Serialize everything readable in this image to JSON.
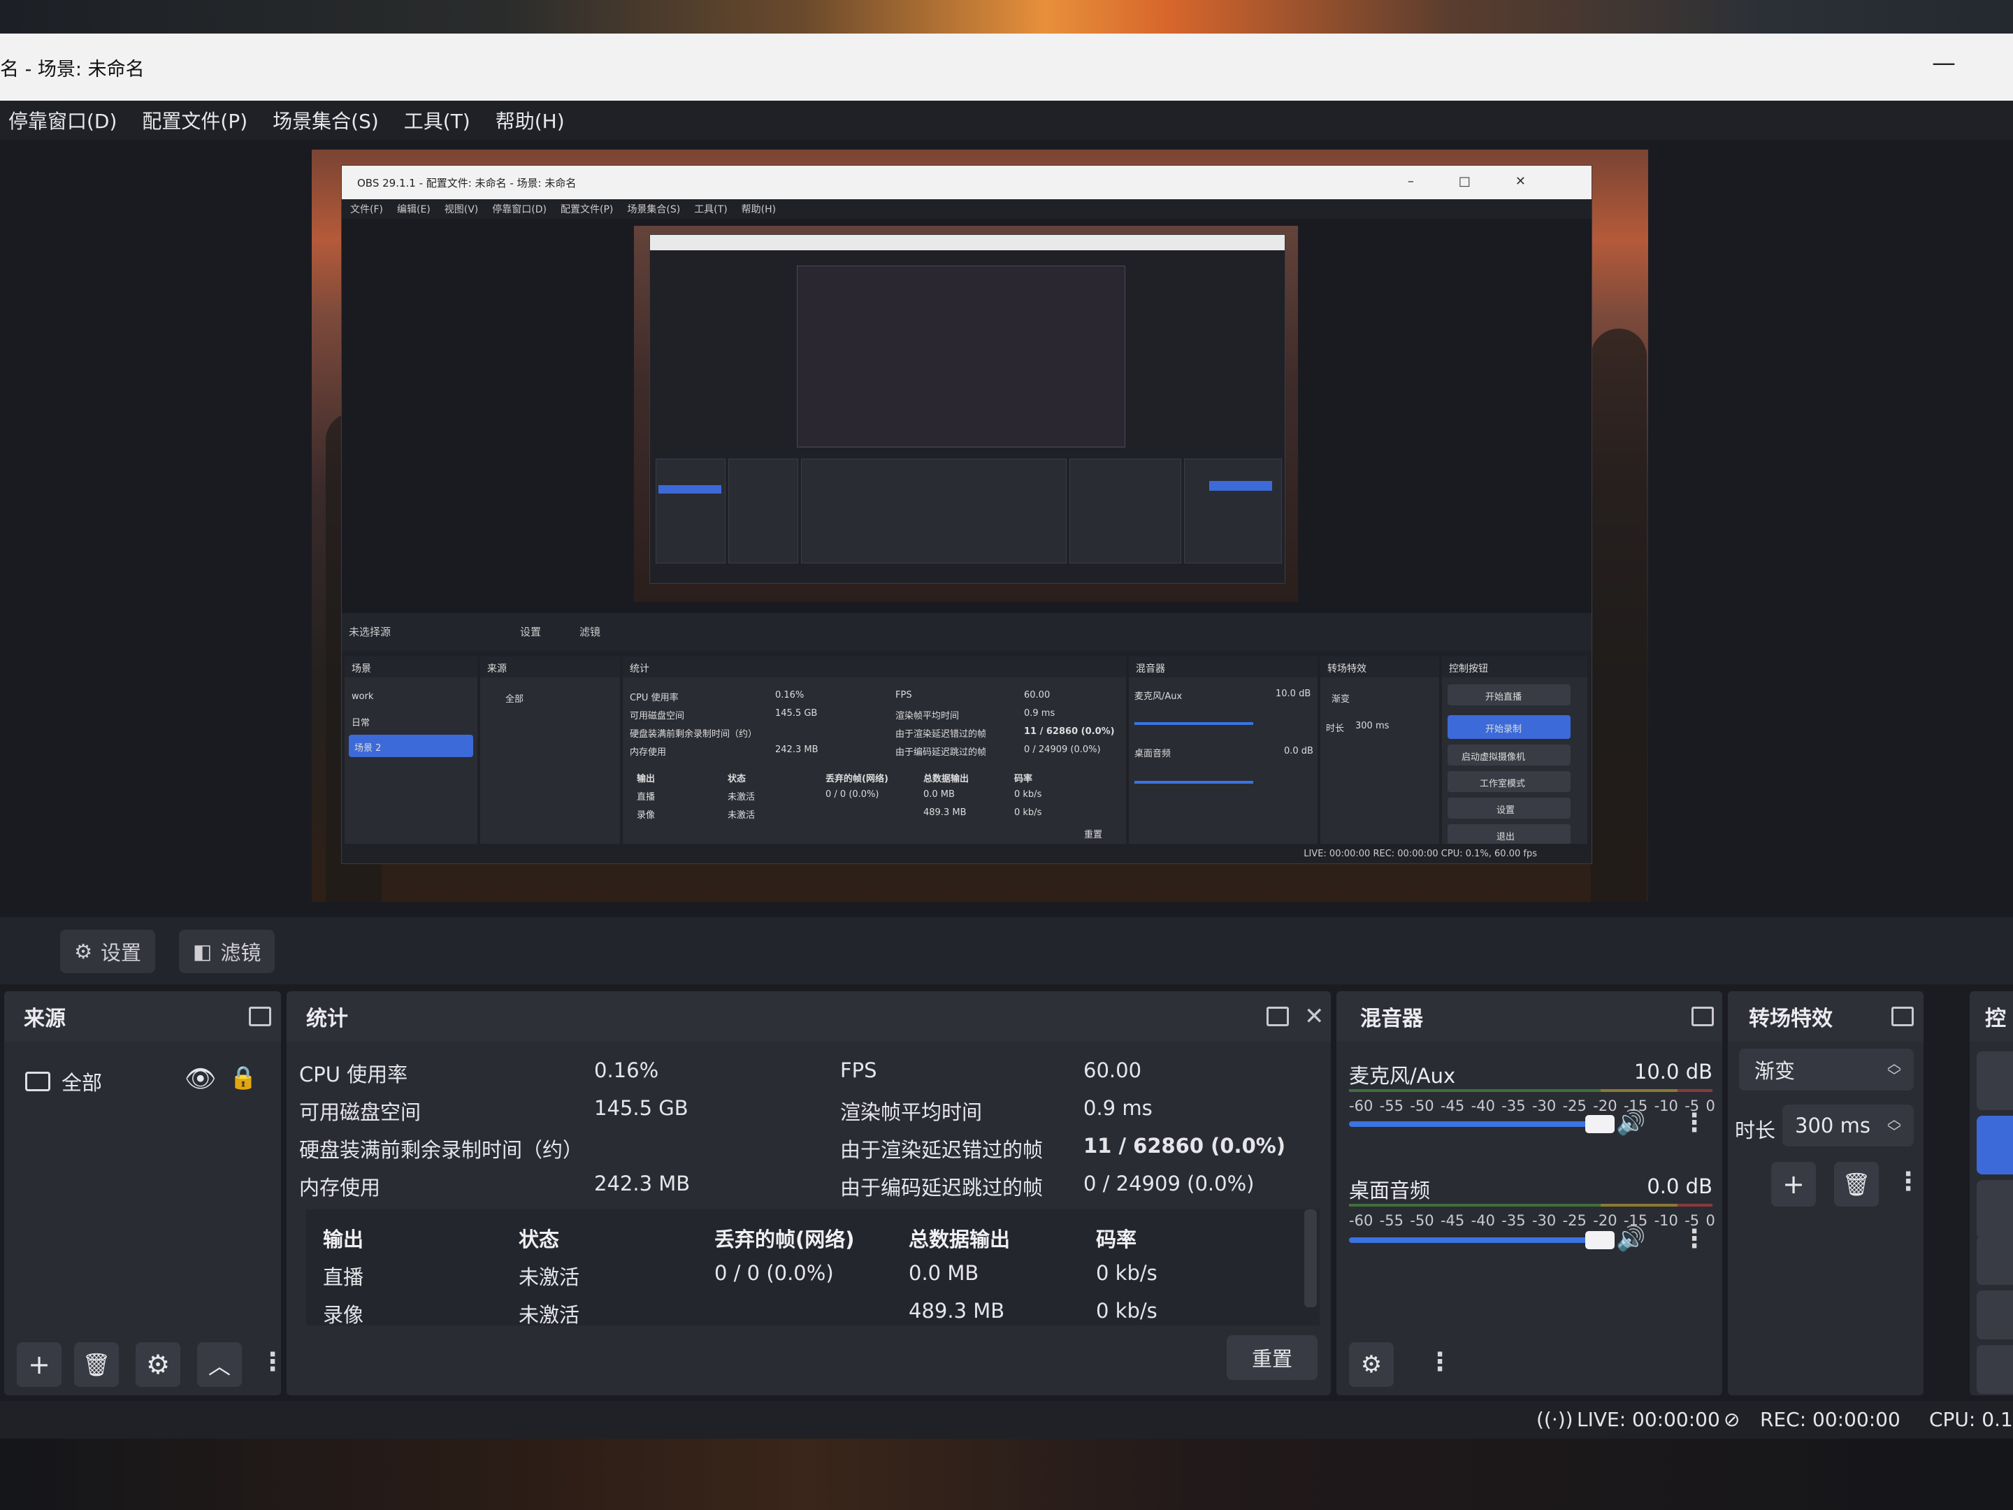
{
  "window": {
    "title": "名 - 场景: 未命名"
  },
  "menu": [
    "停靠窗口(D)",
    "配置文件(P)",
    "场景集合(S)",
    "工具(T)",
    "帮助(H)"
  ],
  "scene_toolbar": {
    "settings": "设置",
    "filters": "滤镜"
  },
  "sources": {
    "title": "来源",
    "items": [
      {
        "name": "全部",
        "visible": true,
        "locked": true
      }
    ]
  },
  "stats": {
    "title": "统计",
    "left": [
      {
        "label": "CPU 使用率",
        "value": "0.16%"
      },
      {
        "label": "可用磁盘空间",
        "value": "145.5 GB"
      },
      {
        "label": "硬盘装满前剩余录制时间（约）",
        "value": ""
      },
      {
        "label": "内存使用",
        "value": "242.3 MB"
      }
    ],
    "right": [
      {
        "label": "FPS",
        "value": "60.00"
      },
      {
        "label": "渲染帧平均时间",
        "value": "0.9 ms"
      },
      {
        "label": "由于渲染延迟错过的帧",
        "value": "11 / 62860 (0.0%)"
      },
      {
        "label": "由于编码延迟跳过的帧",
        "value": "0 / 24909 (0.0%)"
      }
    ],
    "output_table": {
      "headers": [
        "输出",
        "状态",
        "丢弃的帧(网络)",
        "总数据输出",
        "码率"
      ],
      "rows": [
        [
          "直播",
          "未激活",
          "0 / 0 (0.0%)",
          "0.0 MB",
          "0 kb/s"
        ],
        [
          "录像",
          "未激活",
          "",
          "489.3 MB",
          "0 kb/s"
        ]
      ]
    },
    "reset": "重置"
  },
  "mixer": {
    "title": "混音器",
    "scale": [
      "-60",
      "-55",
      "-50",
      "-45",
      "-40",
      "-35",
      "-30",
      "-25",
      "-20",
      "-15",
      "-10",
      "-5",
      "0"
    ],
    "channels": [
      {
        "name": "麦克风/Aux",
        "db": "10.0 dB",
        "volume": 0.92
      },
      {
        "name": "桌面音频",
        "db": "0.0 dB",
        "volume": 0.92
      }
    ]
  },
  "transitions": {
    "title": "转场特效",
    "selected": "渐变",
    "duration_label": "时长",
    "duration": "300 ms"
  },
  "controls": {
    "title": "控"
  },
  "status": {
    "live": "LIVE: 00:00:00",
    "rec": "REC: 00:00:00",
    "cpu": "CPU: 0.1"
  },
  "nested_preview": {
    "title": "OBS 29.1.1 - 配置文件: 未命名 - 场景: 未命名",
    "menu": [
      "文件(F)",
      "编辑(E)",
      "视图(V)",
      "停靠窗口(D)",
      "配置文件(P)",
      "场景集合(S)",
      "工具(T)",
      "帮助(H)"
    ],
    "toolbar_label": "未选择源",
    "toolbar_settings": "设置",
    "toolbar_filters": "滤镜",
    "dock_titles": [
      "场景",
      "来源",
      "统计",
      "混音器",
      "转场特效",
      "控制按钮"
    ],
    "scenes": [
      "work",
      "日常",
      "场景 2"
    ],
    "sources_item": "全部",
    "stats_lines": [
      "CPU 使用率",
      "可用磁盘空间",
      "硬盘装满前剩余录制时间（约）",
      "内存使用"
    ],
    "stats_values": [
      "0.16%",
      "145.5 GB",
      "",
      "242.3 MB"
    ],
    "stats_right_lines": [
      "FPS",
      "渲染帧平均时间",
      "由于渲染延迟错过的帧",
      "由于编码延迟跳过的帧"
    ],
    "stats_right_values": [
      "60.00",
      "0.9 ms",
      "11 / 62860 (0.0%)",
      "0 / 24909 (0.0%)"
    ],
    "table_headers": [
      "输出",
      "状态",
      "丢弃的帧(网络)",
      "总数据输出",
      "码率"
    ],
    "table_row1": [
      "直播",
      "未激活",
      "0 / 0 (0.0%)",
      "0.0 MB",
      "0 kb/s"
    ],
    "table_row2": [
      "录像",
      "未激活",
      "",
      "489.3 MB",
      "0 kb/s"
    ],
    "reset": "重置",
    "mixer_ch1": "麦克风/Aux",
    "mixer_db1": "10.0 dB",
    "mixer_ch2": "桌面音频",
    "mixer_db2": "0.0 dB",
    "transition": "渐变",
    "duration_label": "时长",
    "duration": "300 ms",
    "controls": [
      "开始直播",
      "开始录制",
      "启动虚拟摄像机",
      "工作室模式",
      "设置",
      "退出"
    ],
    "status": "LIVE: 00:00:00    REC: 00:00:00    CPU: 0.1%, 60.00 fps"
  },
  "colors": {
    "accent": "#3c6ad8",
    "panel": "#2a2c34",
    "bg": "#1b1c22"
  }
}
